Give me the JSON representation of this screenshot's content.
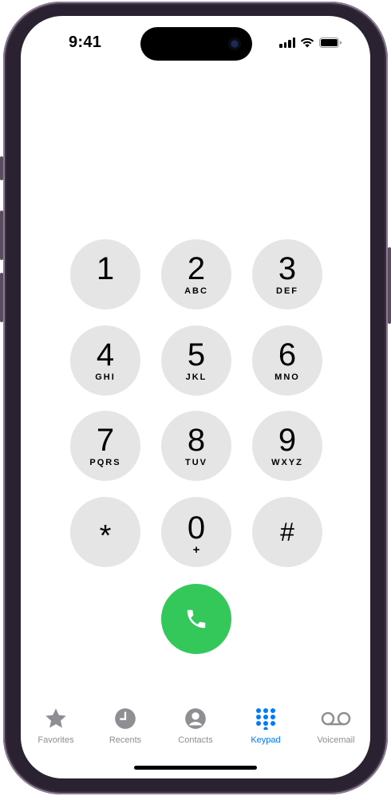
{
  "status_bar": {
    "time": "9:41"
  },
  "keypad": {
    "keys": [
      {
        "digit": "1",
        "letters": ""
      },
      {
        "digit": "2",
        "letters": "ABC"
      },
      {
        "digit": "3",
        "letters": "DEF"
      },
      {
        "digit": "4",
        "letters": "GHI"
      },
      {
        "digit": "5",
        "letters": "JKL"
      },
      {
        "digit": "6",
        "letters": "MNO"
      },
      {
        "digit": "7",
        "letters": "PQRS"
      },
      {
        "digit": "8",
        "letters": "TUV"
      },
      {
        "digit": "9",
        "letters": "WXYZ"
      }
    ],
    "star": "*",
    "zero": {
      "digit": "0",
      "letters": "+"
    },
    "hash": "#"
  },
  "call_button": {
    "icon": "phone-icon",
    "color": "#34c759"
  },
  "tabbar": {
    "tabs": [
      {
        "label": "Favorites",
        "icon": "star-icon",
        "active": false
      },
      {
        "label": "Recents",
        "icon": "clock-icon",
        "active": false
      },
      {
        "label": "Contacts",
        "icon": "person-icon",
        "active": false
      },
      {
        "label": "Keypad",
        "icon": "keypad-icon",
        "active": true
      },
      {
        "label": "Voicemail",
        "icon": "voicemail-icon",
        "active": false
      }
    ],
    "active_color": "#007aff",
    "inactive_color": "#8e8e93"
  }
}
